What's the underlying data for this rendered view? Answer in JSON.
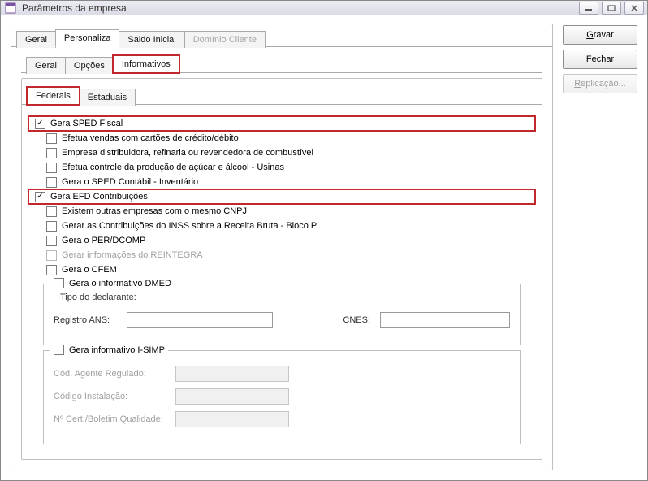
{
  "window": {
    "title": "Parâmetros da empresa"
  },
  "outer_tabs": {
    "geral": "Geral",
    "personaliza": "Personaliza",
    "saldo_inicial": "Saldo Inicial",
    "dominio_cliente": "Domínio Cliente"
  },
  "inner_tabs": {
    "geral": "Geral",
    "opcoes": "Opções",
    "informativos": "Informativos"
  },
  "sub_tabs": {
    "federais": "Federais",
    "estaduais": "Estaduais"
  },
  "checks": {
    "sped_fiscal": "Gera SPED Fiscal",
    "vendas_cartao": "Efetua vendas com cartões de crédito/débito",
    "distribuidora": "Empresa distribuidora, refinaria ou revendedora de combustível",
    "controle_acucar": "Efetua controle da produção de açúcar e álcool - Usinas",
    "sped_contabil": "Gera o SPED Contábil - Inventário",
    "efd_contrib": "Gera EFD Contribuições",
    "outras_cnpj": "Existem outras empresas com o mesmo CNPJ",
    "inss_bloco_p": "Gerar as Contribuições do INSS sobre a Receita Bruta - Bloco P",
    "per_dcomp": "Gera o PER/DCOMP",
    "reintegra": "Gerar informações do REINTEGRA",
    "cfem": "Gera o CFEM"
  },
  "group_dmed": {
    "title": "Gera o informativo DMED",
    "tipo_label": "Tipo do declarante:",
    "registro_ans_label": "Registro ANS:",
    "cnes_label": "CNES:",
    "registro_ans_value": "",
    "cnes_value": ""
  },
  "group_isimp": {
    "title": "Gera informativo I-SIMP",
    "cod_agente_label": "Cód. Agente Regulado:",
    "codigo_instalacao_label": "Código Instalação:",
    "cert_label": "Nº Cert./Boletim Qualidade:",
    "cod_agente_value": "",
    "codigo_instalacao_value": "",
    "cert_value": ""
  },
  "buttons": {
    "gravar": "Gravar",
    "fechar": "Fechar",
    "replicacao": "Replicação..."
  }
}
